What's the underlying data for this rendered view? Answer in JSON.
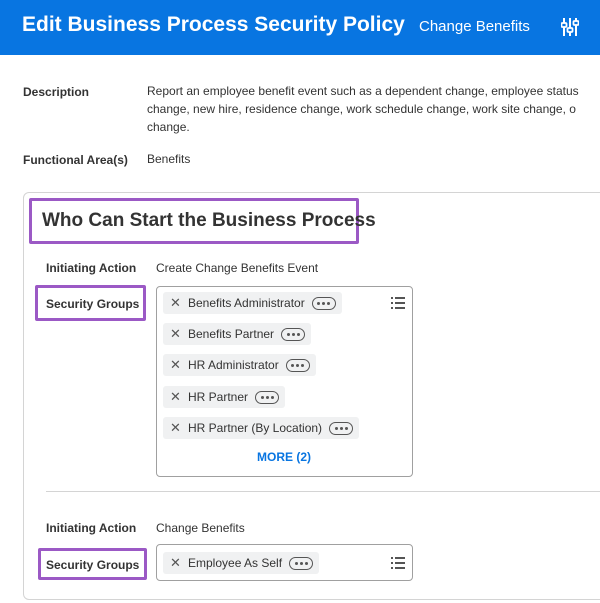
{
  "header": {
    "title": "Edit Business Process Security Policy",
    "subtitle": "Change Benefits",
    "settings_icon": "sliders-icon"
  },
  "description": {
    "label": "Description",
    "lines": [
      "Report an employee benefit event such as a dependent change, employee status",
      "change, new hire, residence change, work schedule change, work site change, o",
      "change."
    ]
  },
  "functional_area": {
    "label": "Functional Area(s)",
    "value": "Benefits"
  },
  "section": {
    "title": "Who Can Start the Business Process",
    "highlight_color": "#9b59c5",
    "groups": [
      {
        "initiating_label": "Initiating Action",
        "initiating_value": "Create Change Benefits Event",
        "security_label": "Security Groups",
        "items": [
          "Benefits Administrator",
          "Benefits Partner",
          "HR Administrator",
          "HR Partner",
          "HR Partner (By Location)"
        ],
        "more_label": "MORE (2)"
      },
      {
        "initiating_label": "Initiating Action",
        "initiating_value": "Change Benefits",
        "security_label": "Security Groups",
        "items": [
          "Employee As Self"
        ]
      }
    ]
  },
  "colors": {
    "header_bg": "#0875e1",
    "link": "#0875e1",
    "highlight": "#9b59c5"
  }
}
